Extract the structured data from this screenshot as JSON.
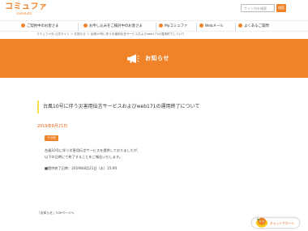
{
  "header": {
    "logo_main": "コミュファ",
    "logo_sub": "commufa",
    "search_placeholder": "サイト内を検索",
    "search_button": "検索"
  },
  "nav": {
    "items": [
      {
        "label": "ご契約中のお客さま"
      },
      {
        "label": "お申し込みをご検討中のお客さま"
      },
      {
        "label": "Myコミュファ"
      },
      {
        "label": "Webメール"
      },
      {
        "label": "よくあるご質問"
      }
    ]
  },
  "breadcrumb": "コミュファ光 公式サイト ＞ お知らせ ＞ 台風10号に伴う災害用伝言サービスおよびweb171の運用終了について",
  "hero": {
    "title": "お知らせ"
  },
  "article": {
    "title": "台風10号に伴う災害用伝言サービスおよびweb171の運用終了について",
    "date": "2019年8月21日",
    "badge": "その他",
    "lines": [
      "台風10号に伴う災害用伝言サービスを提供しておりましたが、",
      "以下の日時にて終了することをご報告いたします。"
    ],
    "end_time": "■提供終了日時：2019年8月21日（水）15:00"
  },
  "footer": {
    "top_link": "「お知らせ」TOPページへ"
  },
  "chat": {
    "label": "チャットサポート"
  },
  "colors": {
    "brand_orange": "#f08228",
    "title_accent": "#f5e24a",
    "date_orange": "#e8641e"
  }
}
